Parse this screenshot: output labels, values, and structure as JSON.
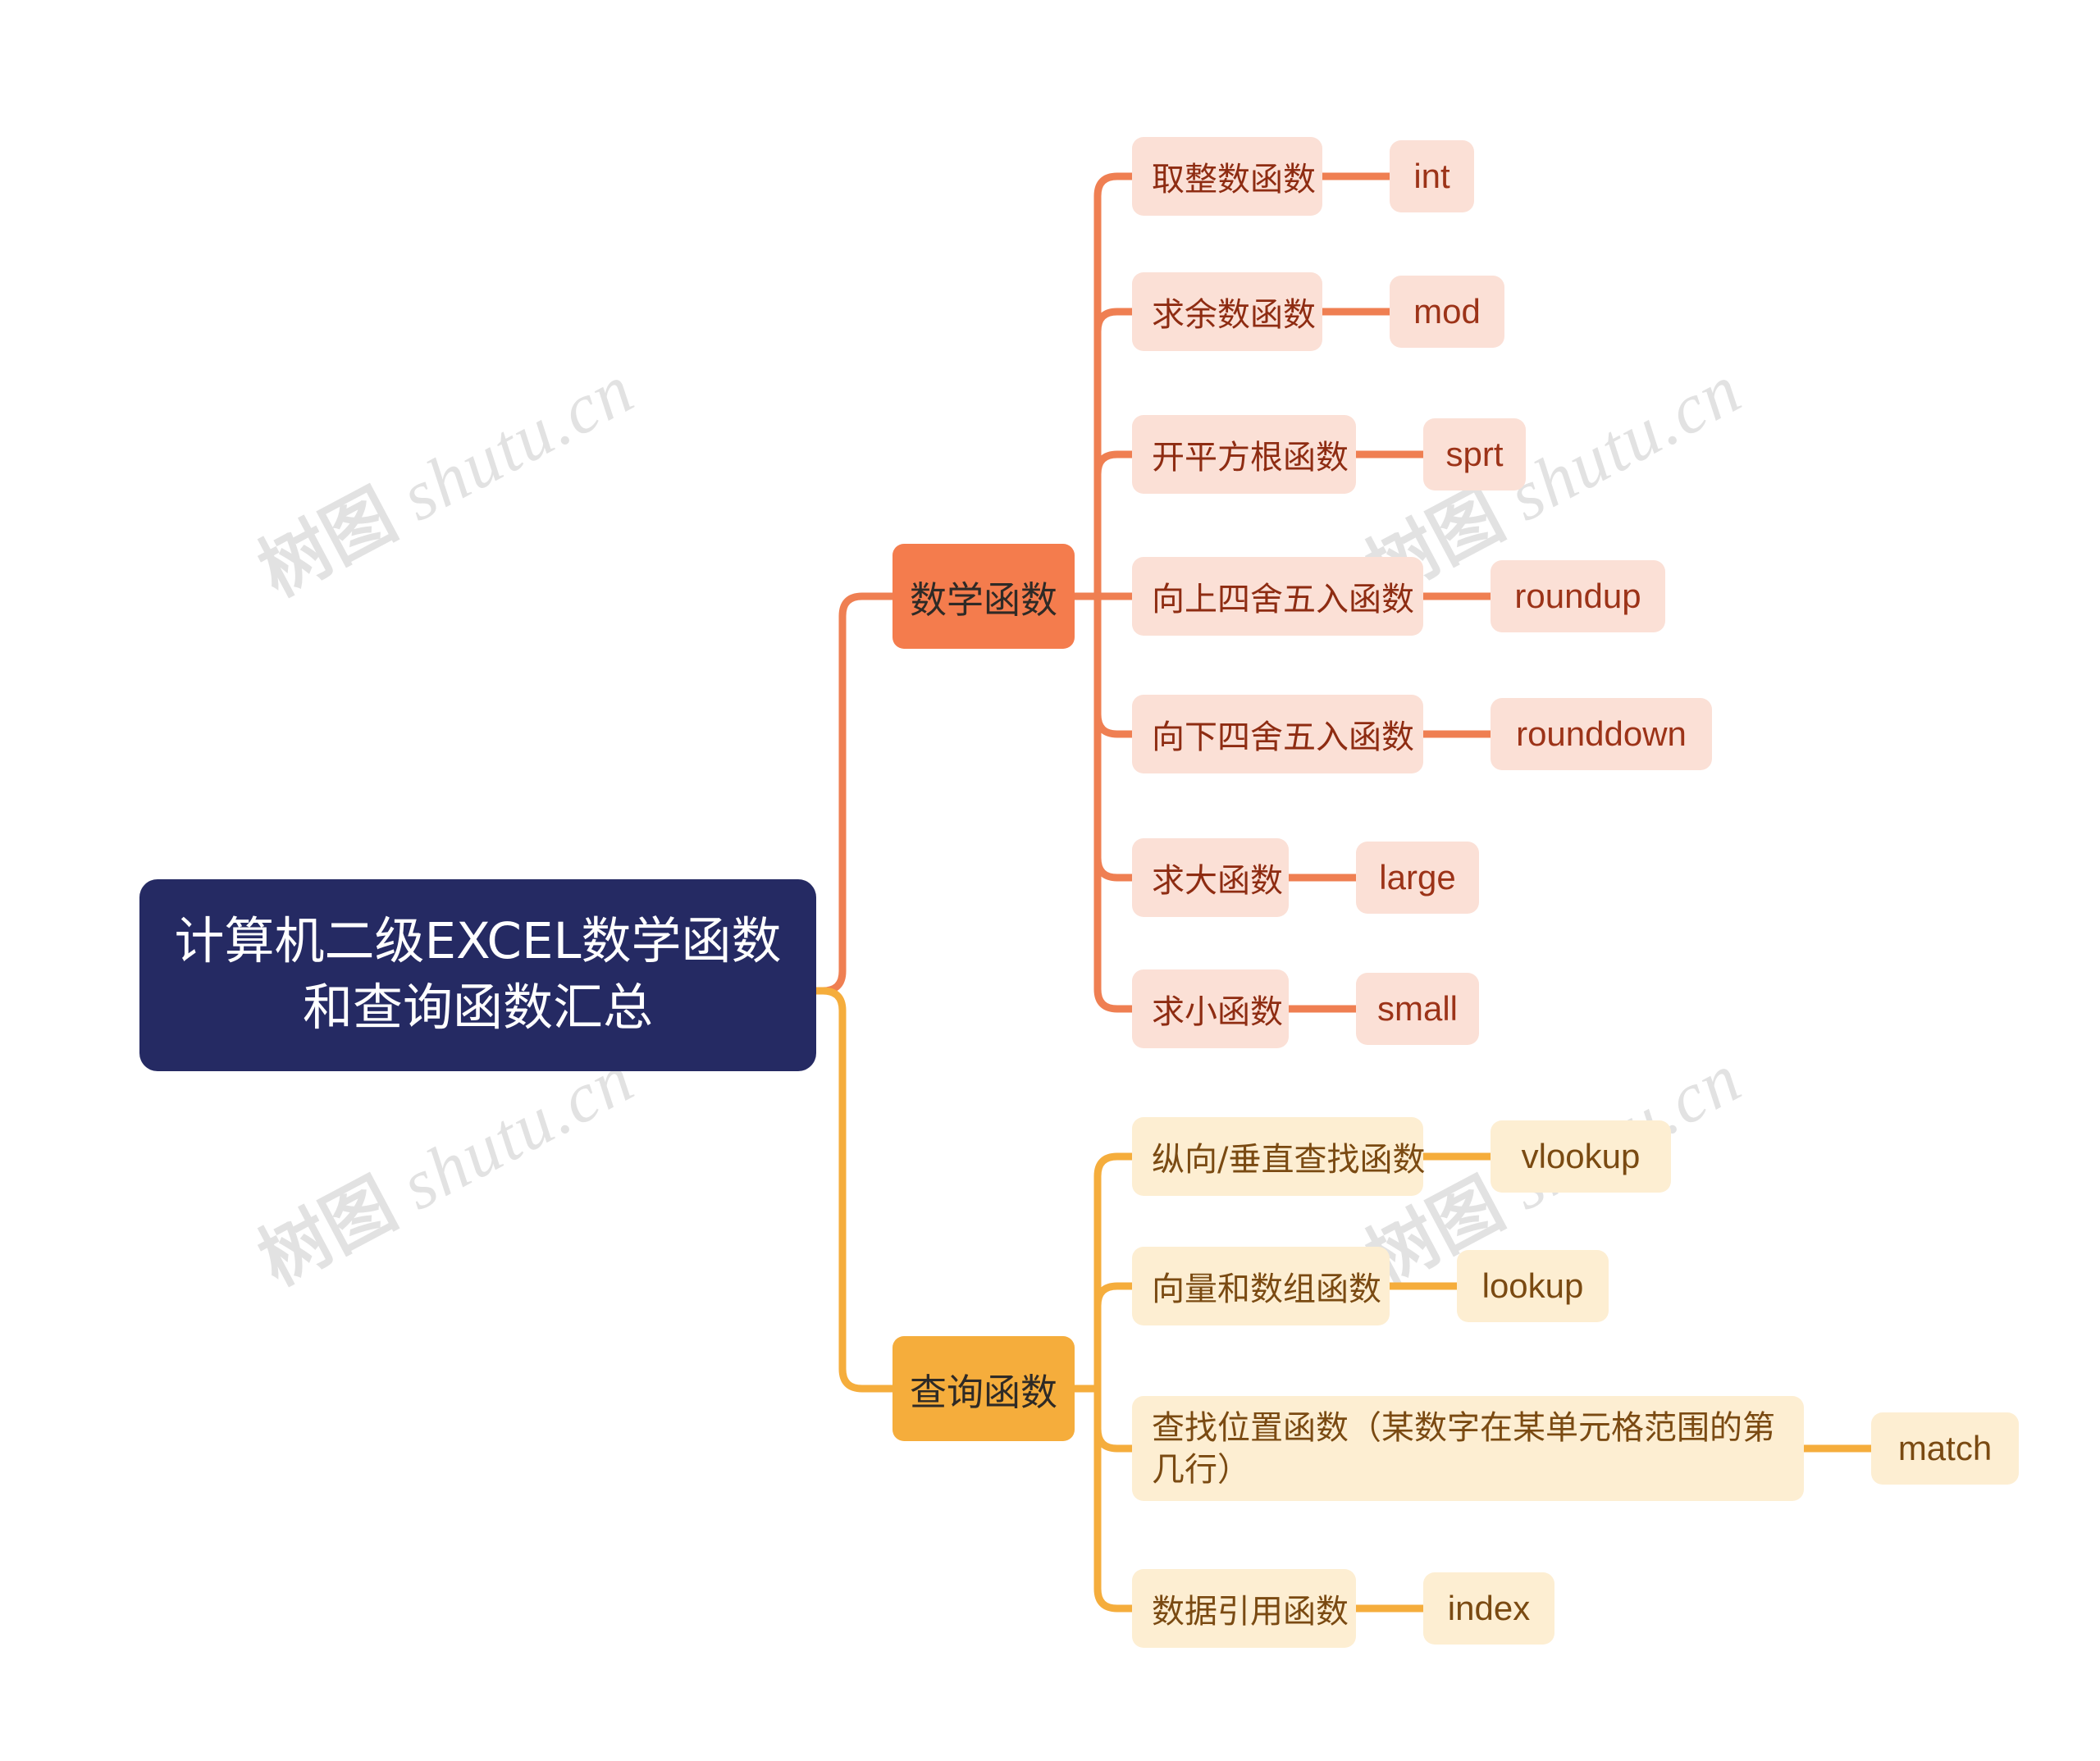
{
  "meta": {
    "colors": {
      "root_bg": "#252a63",
      "root_text": "#ffffff",
      "math_branch_bg": "#f47c4d",
      "query_branch_bg": "#f5ad3c",
      "math_topic_bg": "#fbe0d6",
      "math_topic_text": "#8e2c12",
      "query_topic_bg": "#fdeed2",
      "query_topic_text": "#7a4a12",
      "math_link": "#ef7f52",
      "query_link": "#f5ad3c",
      "canvas_bg": "#ffffff",
      "watermark": "#e2e2e2"
    }
  },
  "watermark": {
    "cjk": "树图",
    "latin": "shutu.cn"
  },
  "root": {
    "label": "计算机二级EXCEL数学函数和查询函数汇总"
  },
  "branches": [
    {
      "label": "数学函数",
      "topics": [
        {
          "label": "取整数函数",
          "leaf": "int"
        },
        {
          "label": "求余数函数",
          "leaf": "mod"
        },
        {
          "label": "开平方根函数",
          "leaf": "sprt"
        },
        {
          "label": "向上四舍五入函数",
          "leaf": "roundup"
        },
        {
          "label": "向下四舍五入函数",
          "leaf": "rounddown"
        },
        {
          "label": "求大函数",
          "leaf": "large"
        },
        {
          "label": "求小函数",
          "leaf": "small"
        }
      ]
    },
    {
      "label": "查询函数",
      "topics": [
        {
          "label": "纵向/垂直查找函数",
          "leaf": "vlookup"
        },
        {
          "label": "向量和数组函数",
          "leaf": "lookup"
        },
        {
          "label": "查找位置函数（某数字在某单元格范围的第几行）",
          "leaf": "match"
        },
        {
          "label": "数据引用函数",
          "leaf": "index"
        }
      ]
    }
  ]
}
